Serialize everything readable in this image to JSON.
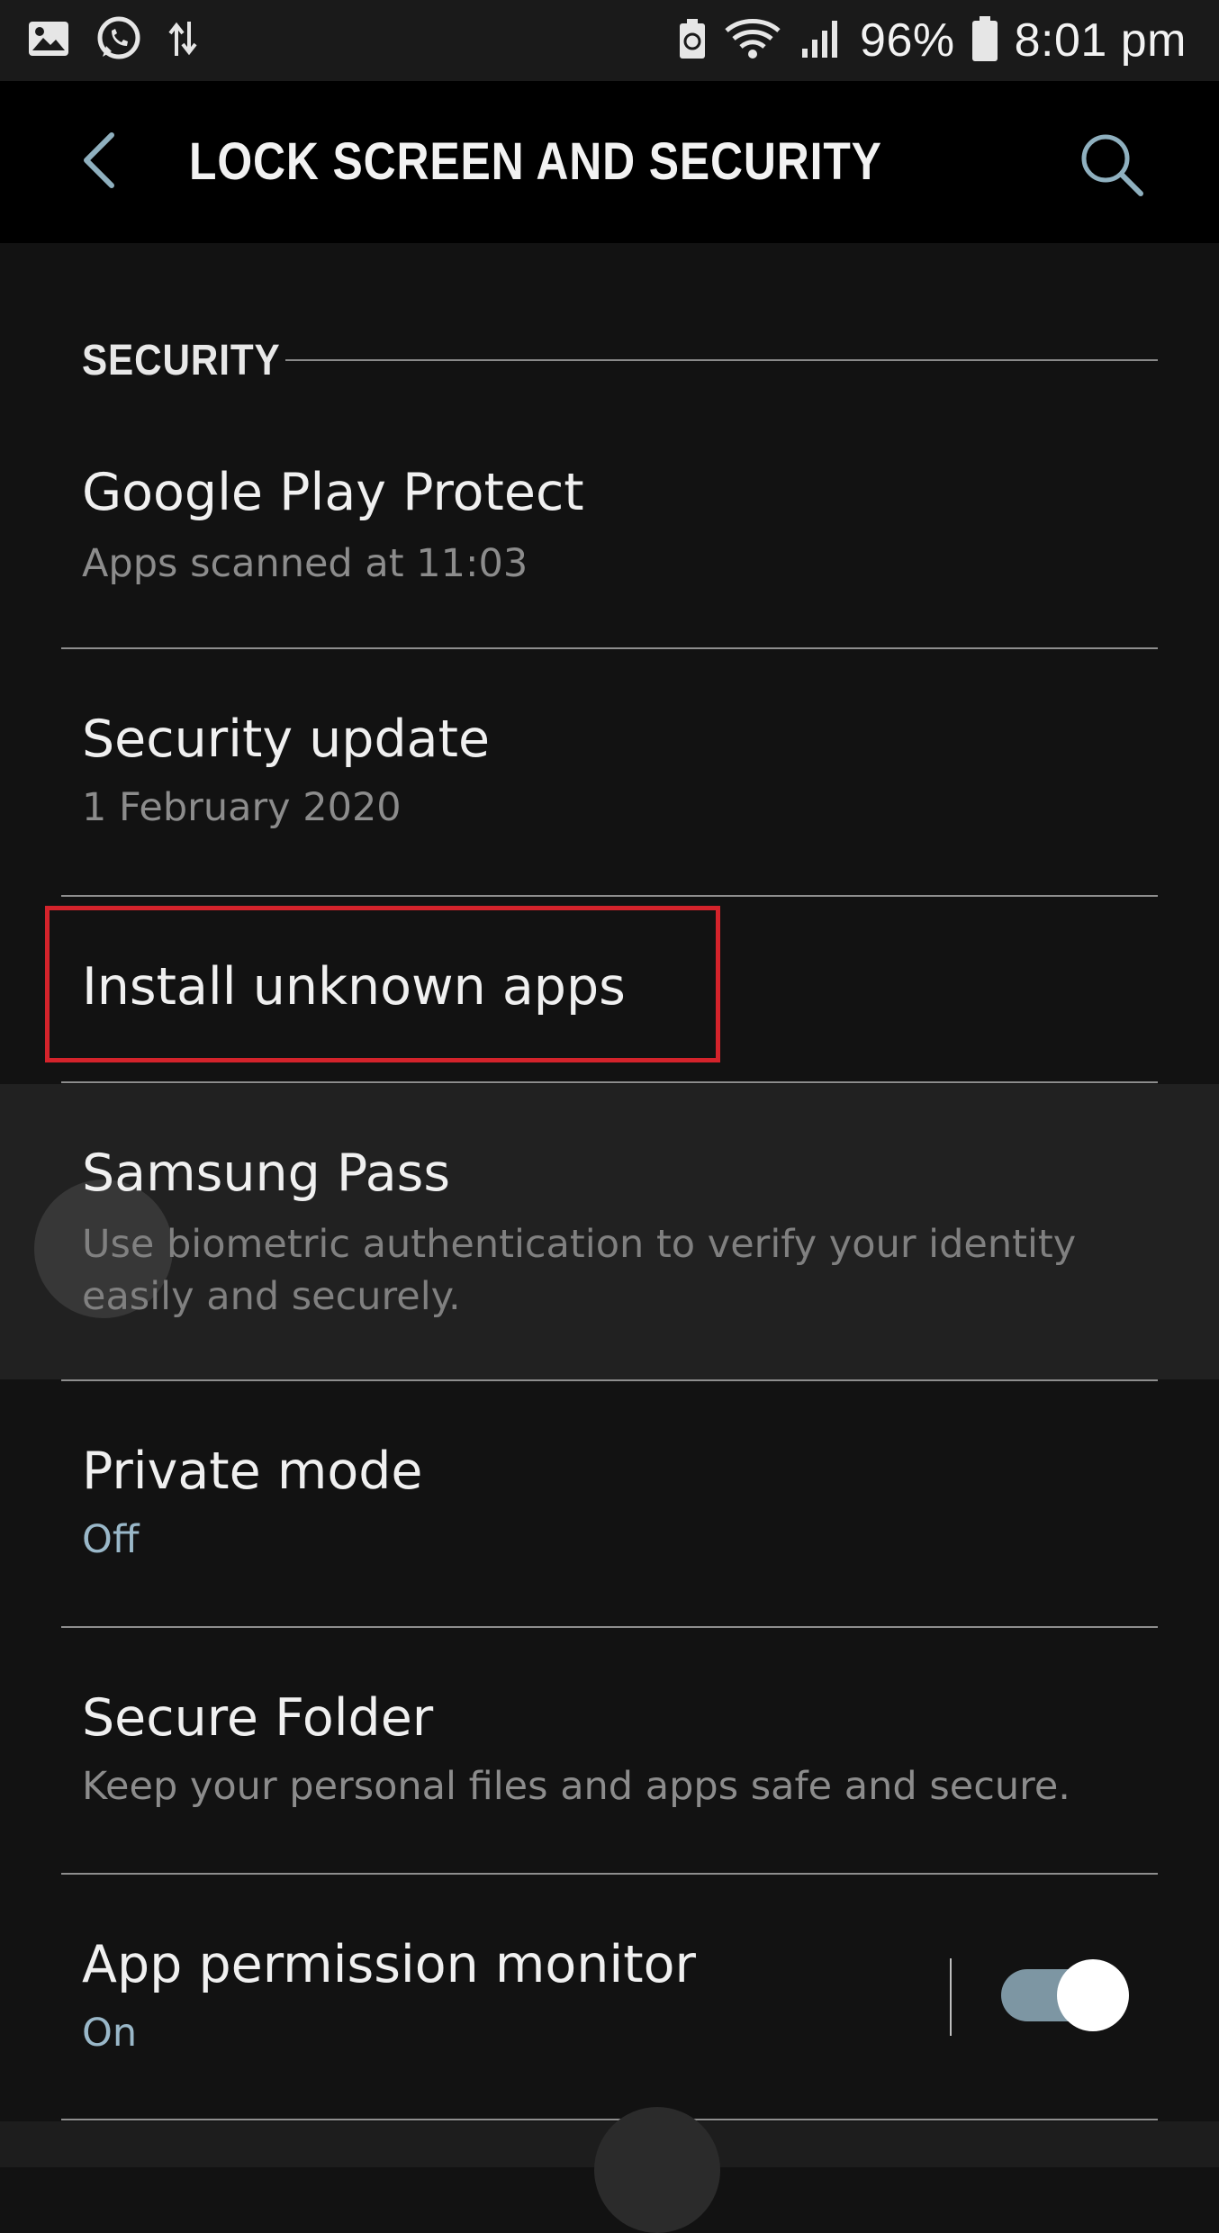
{
  "status_bar": {
    "battery_percent": "96%",
    "time": "8:01 pm",
    "icons": [
      "gallery-icon",
      "whatsapp-icon",
      "data-transfer-icon",
      "battery-saver-icon",
      "wifi-icon",
      "signal-icon",
      "battery-icon"
    ]
  },
  "header": {
    "title": "LOCK SCREEN AND SECURITY",
    "back_icon": "chevron-left-icon",
    "search_icon": "search-icon"
  },
  "section": {
    "label": "SECURITY"
  },
  "items": [
    {
      "title": "Google Play Protect",
      "subtitle": "Apps scanned at 11:03"
    },
    {
      "title": "Security update",
      "subtitle": "1 February 2020"
    },
    {
      "title": "Install unknown apps",
      "subtitle": ""
    },
    {
      "title": "Samsung Pass",
      "subtitle": "Use biometric authentication to verify your identity easily and securely."
    },
    {
      "title": "Private mode",
      "subtitle": "Off"
    },
    {
      "title": "Secure Folder",
      "subtitle": "Keep your personal files and apps safe and secure."
    },
    {
      "title": "App permission monitor",
      "subtitle": "On",
      "toggle_on": true
    }
  ],
  "colors": {
    "background": "#121212",
    "accent_subtitle": "#9ab8c9",
    "highlight": "#d4232b",
    "toggle_track": "#7d96a3"
  }
}
